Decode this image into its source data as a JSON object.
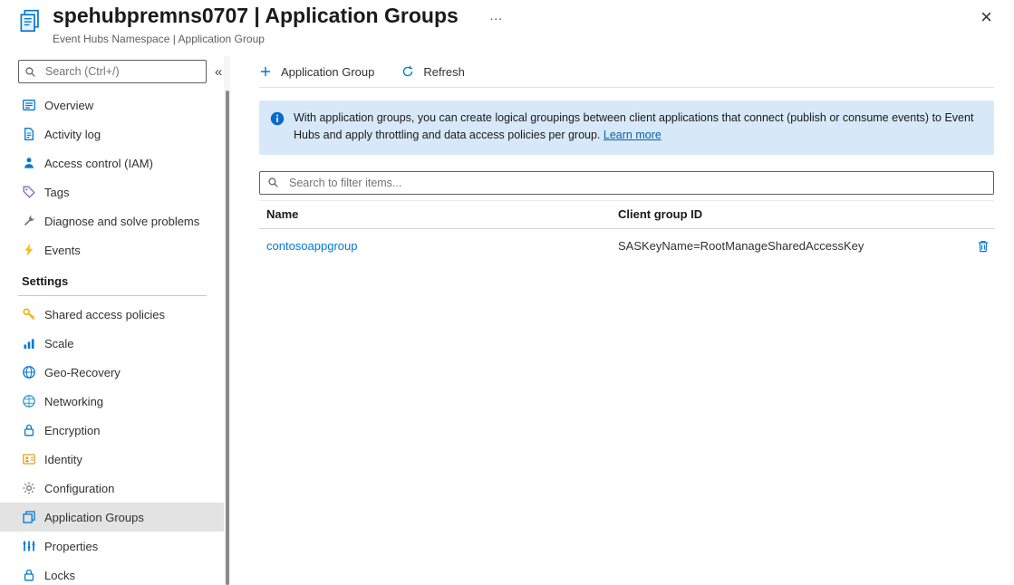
{
  "header": {
    "title": "spehubpremns0707 | Application Groups",
    "subtitle": "Event Hubs Namespace | Application Group",
    "overflow_glyph": "…",
    "close_glyph": "×"
  },
  "sidebar": {
    "search_placeholder": "Search (Ctrl+/)",
    "collapse_glyph": "«",
    "items": [
      {
        "label": "Overview"
      },
      {
        "label": "Activity log"
      },
      {
        "label": "Access control (IAM)"
      },
      {
        "label": "Tags"
      },
      {
        "label": "Diagnose and solve problems"
      },
      {
        "label": "Events"
      }
    ],
    "settings_header": "Settings",
    "settings_items": [
      {
        "label": "Shared access policies"
      },
      {
        "label": "Scale"
      },
      {
        "label": "Geo-Recovery"
      },
      {
        "label": "Networking"
      },
      {
        "label": "Encryption"
      },
      {
        "label": "Identity"
      },
      {
        "label": "Configuration"
      },
      {
        "label": "Application Groups",
        "selected": true
      },
      {
        "label": "Properties"
      },
      {
        "label": "Locks"
      }
    ]
  },
  "toolbar": {
    "add_label": "Application Group",
    "refresh_label": "Refresh"
  },
  "banner": {
    "text": "With application groups, you can create logical groupings between client applications that connect (publish or consume events) to Event Hubs and apply throttling and data access policies per group.",
    "link_label": "Learn more"
  },
  "filter": {
    "placeholder": "Search to filter items..."
  },
  "table": {
    "columns": {
      "name": "Name",
      "client_group_id": "Client group ID"
    },
    "rows": [
      {
        "name": "contosoappgroup",
        "client_group_id": "SASKeyName=RootManageSharedAccessKey"
      }
    ]
  },
  "colors": {
    "accent": "#0078d4",
    "banner_bg": "#d7e8f8",
    "selected_item_bg": "#e3e3e3",
    "link": "#0b61a4"
  }
}
